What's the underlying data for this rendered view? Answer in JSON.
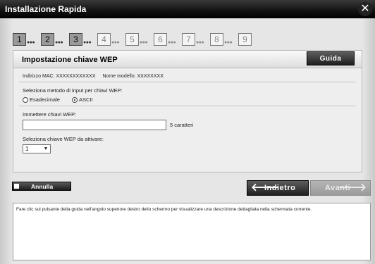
{
  "window": {
    "title": "Installazione Rapida"
  },
  "steps": [
    {
      "label": "1",
      "active": true
    },
    {
      "label": "2",
      "active": true
    },
    {
      "label": "3",
      "active": true
    },
    {
      "label": "4",
      "active": false
    },
    {
      "label": "5",
      "active": false
    },
    {
      "label": "6",
      "active": false
    },
    {
      "label": "7",
      "active": false
    },
    {
      "label": "8",
      "active": false
    },
    {
      "label": "9",
      "active": false
    }
  ],
  "panel": {
    "title": "Impostazione chiave WEP",
    "guide_label": "Guida",
    "mac_label": "Indirizzo MAC: XXXXXXXXXXXX",
    "model_label": "Nome modello: XXXXXXXX",
    "input_method_label": "Seleziona metodo di input per chiavi WEP:",
    "radio_hex": "Esadecimale",
    "radio_ascii": "ASCII",
    "selected_method": "ASCII",
    "enter_keys_label": "Immettere chiavi WEP:",
    "wep_key_value": "",
    "chars_note": "5 caratteri",
    "select_key_label": "Seleziona chiave WEP da attivare:",
    "select_key_value": "1"
  },
  "footer": {
    "cancel_label": "Annulla",
    "back_label": "Indietro",
    "next_label": "Avanti"
  },
  "help": {
    "text": "Fare clic sul pulsante della guida nell'angolo superiore destro dello schermo per visualizzare una descrizione dettagliata nella schermata corrente."
  }
}
